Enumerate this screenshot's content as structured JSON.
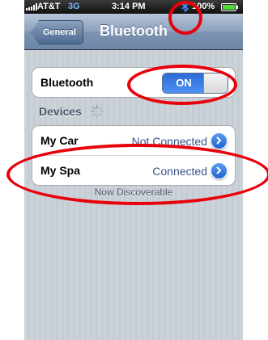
{
  "status_bar": {
    "carrier": "AT&T",
    "network": "3G",
    "time": "3:14 PM",
    "battery": "100%",
    "battery_level": 1.0,
    "bluetooth_icon": "bluetooth-icon"
  },
  "nav": {
    "back_label": "General",
    "title": "Bluetooth"
  },
  "bluetooth_setting": {
    "label": "Bluetooth",
    "toggle_label": "ON"
  },
  "devices": {
    "header": "Devices",
    "items": [
      {
        "name": "My Car",
        "status": "Not Connected"
      },
      {
        "name": "My Spa",
        "status": "Connected"
      }
    ],
    "footer_note": "Now Discoverable"
  },
  "colors": {
    "annotation": "#e8000a",
    "toggle_on": "#2c6bd7",
    "status_text": "#385487"
  }
}
